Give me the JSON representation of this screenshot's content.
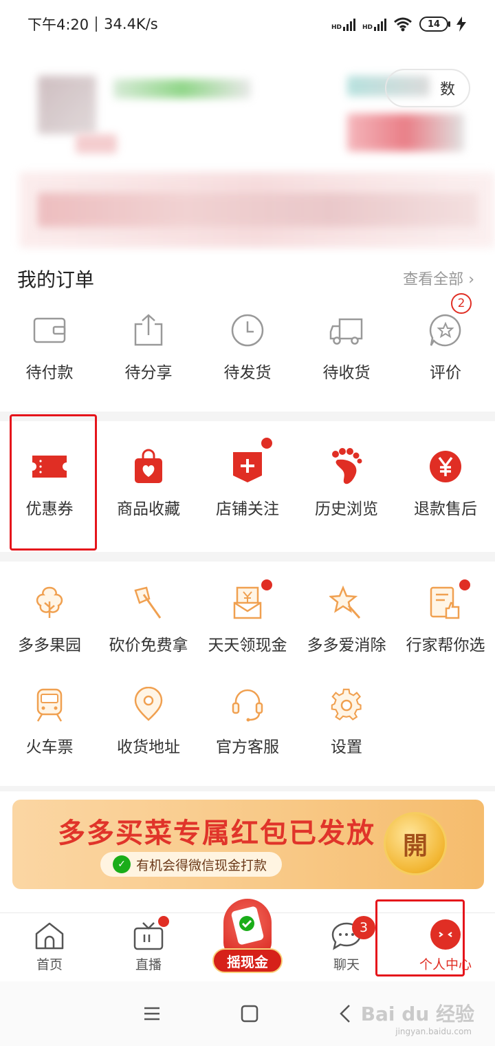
{
  "status_bar": {
    "time": "下午4:20",
    "speed": "34.4K/s",
    "battery": "14",
    "net1": "HD",
    "net2": "HD"
  },
  "header": {
    "count_label": "数"
  },
  "orders": {
    "title": "我的订单",
    "view_all": "查看全部",
    "items": [
      {
        "label": "待付款",
        "icon": "wallet-icon"
      },
      {
        "label": "待分享",
        "icon": "share-icon"
      },
      {
        "label": "待发货",
        "icon": "clock-icon"
      },
      {
        "label": "待收货",
        "icon": "truck-icon"
      },
      {
        "label": "评价",
        "icon": "star-comment-icon",
        "badge": "2"
      }
    ]
  },
  "services": {
    "items": [
      {
        "label": "优惠券",
        "icon": "coupon-icon"
      },
      {
        "label": "商品收藏",
        "icon": "favorite-bag-icon"
      },
      {
        "label": "店铺关注",
        "icon": "store-follow-icon"
      },
      {
        "label": "历史浏览",
        "icon": "footprint-icon"
      },
      {
        "label": "退款售后",
        "icon": "yuan-refund-icon"
      }
    ]
  },
  "tools": {
    "row1": [
      {
        "label": "多多果园",
        "icon": "tree-icon"
      },
      {
        "label": "砍价免费拿",
        "icon": "axe-icon"
      },
      {
        "label": "天天领现金",
        "icon": "cash-icon"
      },
      {
        "label": "多多爱消除",
        "icon": "star-wand-icon"
      },
      {
        "label": "行家帮你选",
        "icon": "thumbs-up-doc-icon"
      }
    ],
    "row2": [
      {
        "label": "火车票",
        "icon": "train-icon"
      },
      {
        "label": "收货地址",
        "icon": "location-icon"
      },
      {
        "label": "官方客服",
        "icon": "headset-icon"
      },
      {
        "label": "设置",
        "icon": "gear-icon"
      }
    ]
  },
  "banner": {
    "title": "多多买菜专属红包已发放",
    "subtitle": "有机会得微信现金打款",
    "open": "開"
  },
  "tabbar": {
    "items": [
      {
        "label": "首页"
      },
      {
        "label": "直播"
      },
      {
        "label": "摇现金"
      },
      {
        "label": "聊天",
        "badge": "3"
      },
      {
        "label": "个人中心"
      }
    ]
  },
  "watermark": {
    "main": "Bai du 经验",
    "sub": "jingyan.baidu.com"
  },
  "colors": {
    "accent": "#e02e24",
    "highlight_box": "#e5141b",
    "orange_icon": "#f0a050"
  }
}
